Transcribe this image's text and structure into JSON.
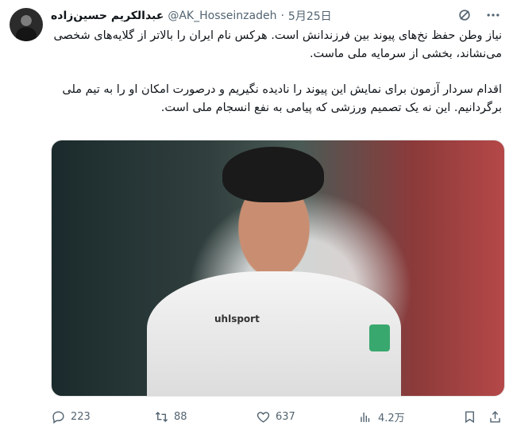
{
  "tweet": {
    "author": {
      "name": "عبدالکریم حسین‌زاده",
      "handle": "@AK_Hosseinzadeh",
      "separator": "·",
      "date": "5月25日"
    },
    "text": {
      "paragraph1": "نیاز وطن حفظ نخ‌های پیوند بین فرزندانش است. هرکس نام ایران را بالاتر از گلایه‌های شخصی می‌نشاند، بخشی از سرمایه ملی ماست.",
      "paragraph2": "اقدام سردار آزمون برای نمایش این پیوند را نادیده نگیریم و درصورت امکان او را به تیم ملی برگردانیم. این نه یک تصمیم ورزشی که پیامی به نفع انسجام ملی است."
    },
    "media": {
      "jersey_text": "uhlsport"
    },
    "metrics": {
      "replies": "223",
      "retweets": "88",
      "likes": "637",
      "views": "4.2万"
    }
  },
  "icons": {
    "grok": "grok-icon",
    "more": "more-icon",
    "reply": "reply-icon",
    "retweet": "retweet-icon",
    "like": "heart-icon",
    "views": "views-icon",
    "bookmark": "bookmark-icon",
    "share": "share-icon"
  },
  "colors": {
    "text": "#0f1419",
    "muted": "#536471",
    "background": "#ffffff"
  }
}
